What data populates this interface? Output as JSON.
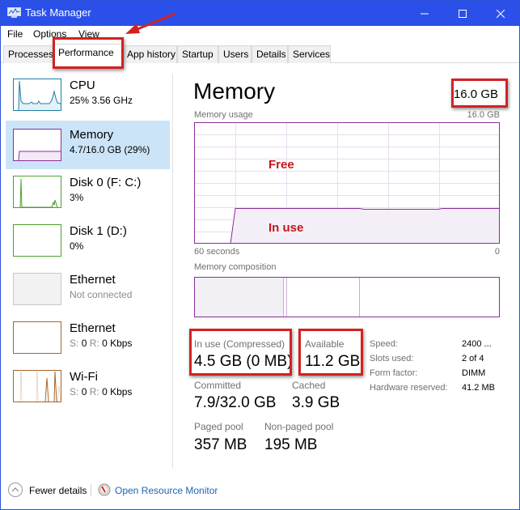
{
  "window": {
    "title": "Task Manager",
    "controls": {
      "minimize": "minimize",
      "maximize": "maximize",
      "close": "close"
    },
    "titlebar_color": "#2b50ea"
  },
  "menu": [
    "File",
    "Options",
    "View"
  ],
  "tabs": [
    {
      "label": "Processes",
      "active": false
    },
    {
      "label": "Performance",
      "active": true
    },
    {
      "label": "App history",
      "active": false
    },
    {
      "label": "Startup",
      "active": false
    },
    {
      "label": "Users",
      "active": false
    },
    {
      "label": "Details",
      "active": false
    },
    {
      "label": "Services",
      "active": false
    }
  ],
  "sidebar": {
    "items": [
      {
        "title": "CPU",
        "subtitle": "25% 3.56 GHz",
        "color": "#1b7ea3",
        "selected": false,
        "icon": "cpu-graph"
      },
      {
        "title": "Memory",
        "subtitle": "4.7/16.0 GB (29%)",
        "color": "#8b2d9b",
        "selected": true,
        "icon": "memory-graph"
      },
      {
        "title": "Disk 0 (F: C:)",
        "subtitle": "3%",
        "color": "#4da12b",
        "selected": false,
        "icon": "disk-graph"
      },
      {
        "title": "Disk 1 (D:)",
        "subtitle": "0%",
        "color": "#4da12b",
        "selected": false,
        "icon": "disk-graph"
      },
      {
        "title": "Ethernet",
        "subtitle": "Not connected",
        "color": "#c8c8c8",
        "selected": false,
        "icon": "ethernet-graph"
      },
      {
        "title": "Ethernet",
        "subtitle_parts": {
          "s_label": "S:",
          "s_value": "0",
          "r_label": "R:",
          "r_value": "0 Kbps"
        },
        "color": "#a7642a",
        "selected": false,
        "icon": "ethernet-graph"
      },
      {
        "title": "Wi-Fi",
        "subtitle_parts": {
          "s_label": "S:",
          "s_value": "0",
          "r_label": "R:",
          "r_value": "0 Kbps"
        },
        "color": "#a7642a",
        "selected": false,
        "icon": "wifi-graph"
      }
    ]
  },
  "main": {
    "title": "Memory",
    "total": "16.0 GB",
    "usage_chart": {
      "label": "Memory usage",
      "max_label": "16.0 GB",
      "x_left": "60 seconds",
      "x_right": "0",
      "color": "#8b2d9b",
      "in_use_fraction": 0.29,
      "annotation_free": "Free",
      "annotation_in_use": "In use"
    },
    "composition_chart": {
      "label": "Memory composition",
      "segments_fraction": {
        "in_use": 0.29,
        "modified": 0.01,
        "standby": 0.24,
        "free": 0.46
      }
    },
    "stats": {
      "in_use_label": "In use (Compressed)",
      "in_use_value": "4.5 GB (0 MB)",
      "available_label": "Available",
      "available_value": "11.2 GB",
      "committed_label": "Committed",
      "committed_value": "7.9/32.0 GB",
      "cached_label": "Cached",
      "cached_value": "3.9 GB",
      "paged_label": "Paged pool",
      "paged_value": "357 MB",
      "nonpaged_label": "Non-paged pool",
      "nonpaged_value": "195 MB"
    },
    "details": [
      {
        "label": "Speed:",
        "value": "2400 ..."
      },
      {
        "label": "Slots used:",
        "value": "2 of 4"
      },
      {
        "label": "Form factor:",
        "value": "DIMM"
      },
      {
        "label": "Hardware reserved:",
        "value": "41.2 MB"
      }
    ]
  },
  "footer": {
    "fewer_details": "Fewer details",
    "resource_monitor": "Open Resource Monitor"
  }
}
